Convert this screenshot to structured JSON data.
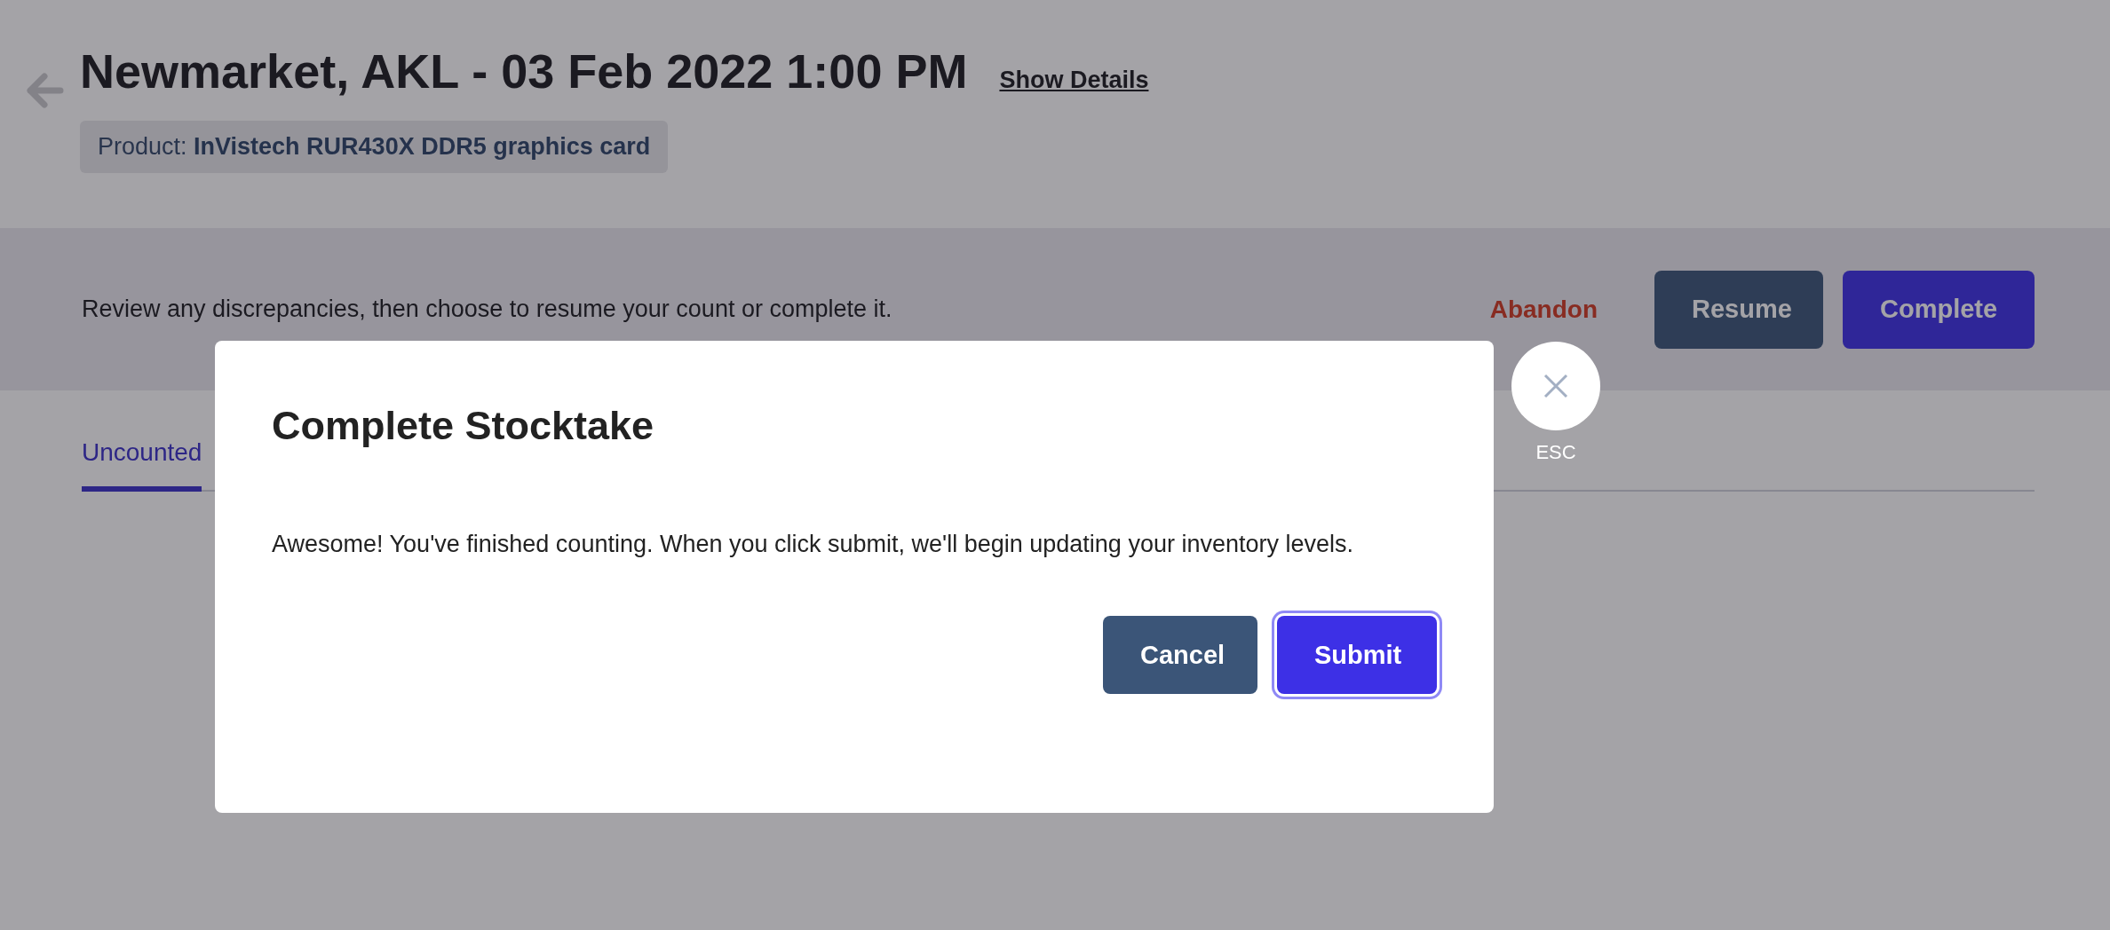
{
  "header": {
    "title": "Newmarket, AKL - 03 Feb 2022 1:00 PM",
    "details_link": "Show Details",
    "product": "Product: **InVistech RUR430X DDR5 graphics card**"
  },
  "action_bar": {
    "message": "Review any discrepancies, then choose to resume your count or complete it.",
    "abandon": "Abandon",
    "buttons": [
      {
        "label": "Resume",
        "kind": "secondary"
      },
      {
        "label": "Complete",
        "kind": "primary"
      }
    ]
  },
  "tabs": [
    {
      "label": "Uncounted",
      "selected": true
    }
  ],
  "modal": {
    "title": "Complete Stocktake",
    "body": "Awesome! You've finished counting. When you click submit, we'll begin updating your inventory levels.",
    "close_hint": "ESC",
    "buttons": [
      {
        "label": "Cancel",
        "kind": "secondary",
        "focused": false
      },
      {
        "label": "Submit",
        "kind": "primary",
        "focused": true
      }
    ]
  }
}
